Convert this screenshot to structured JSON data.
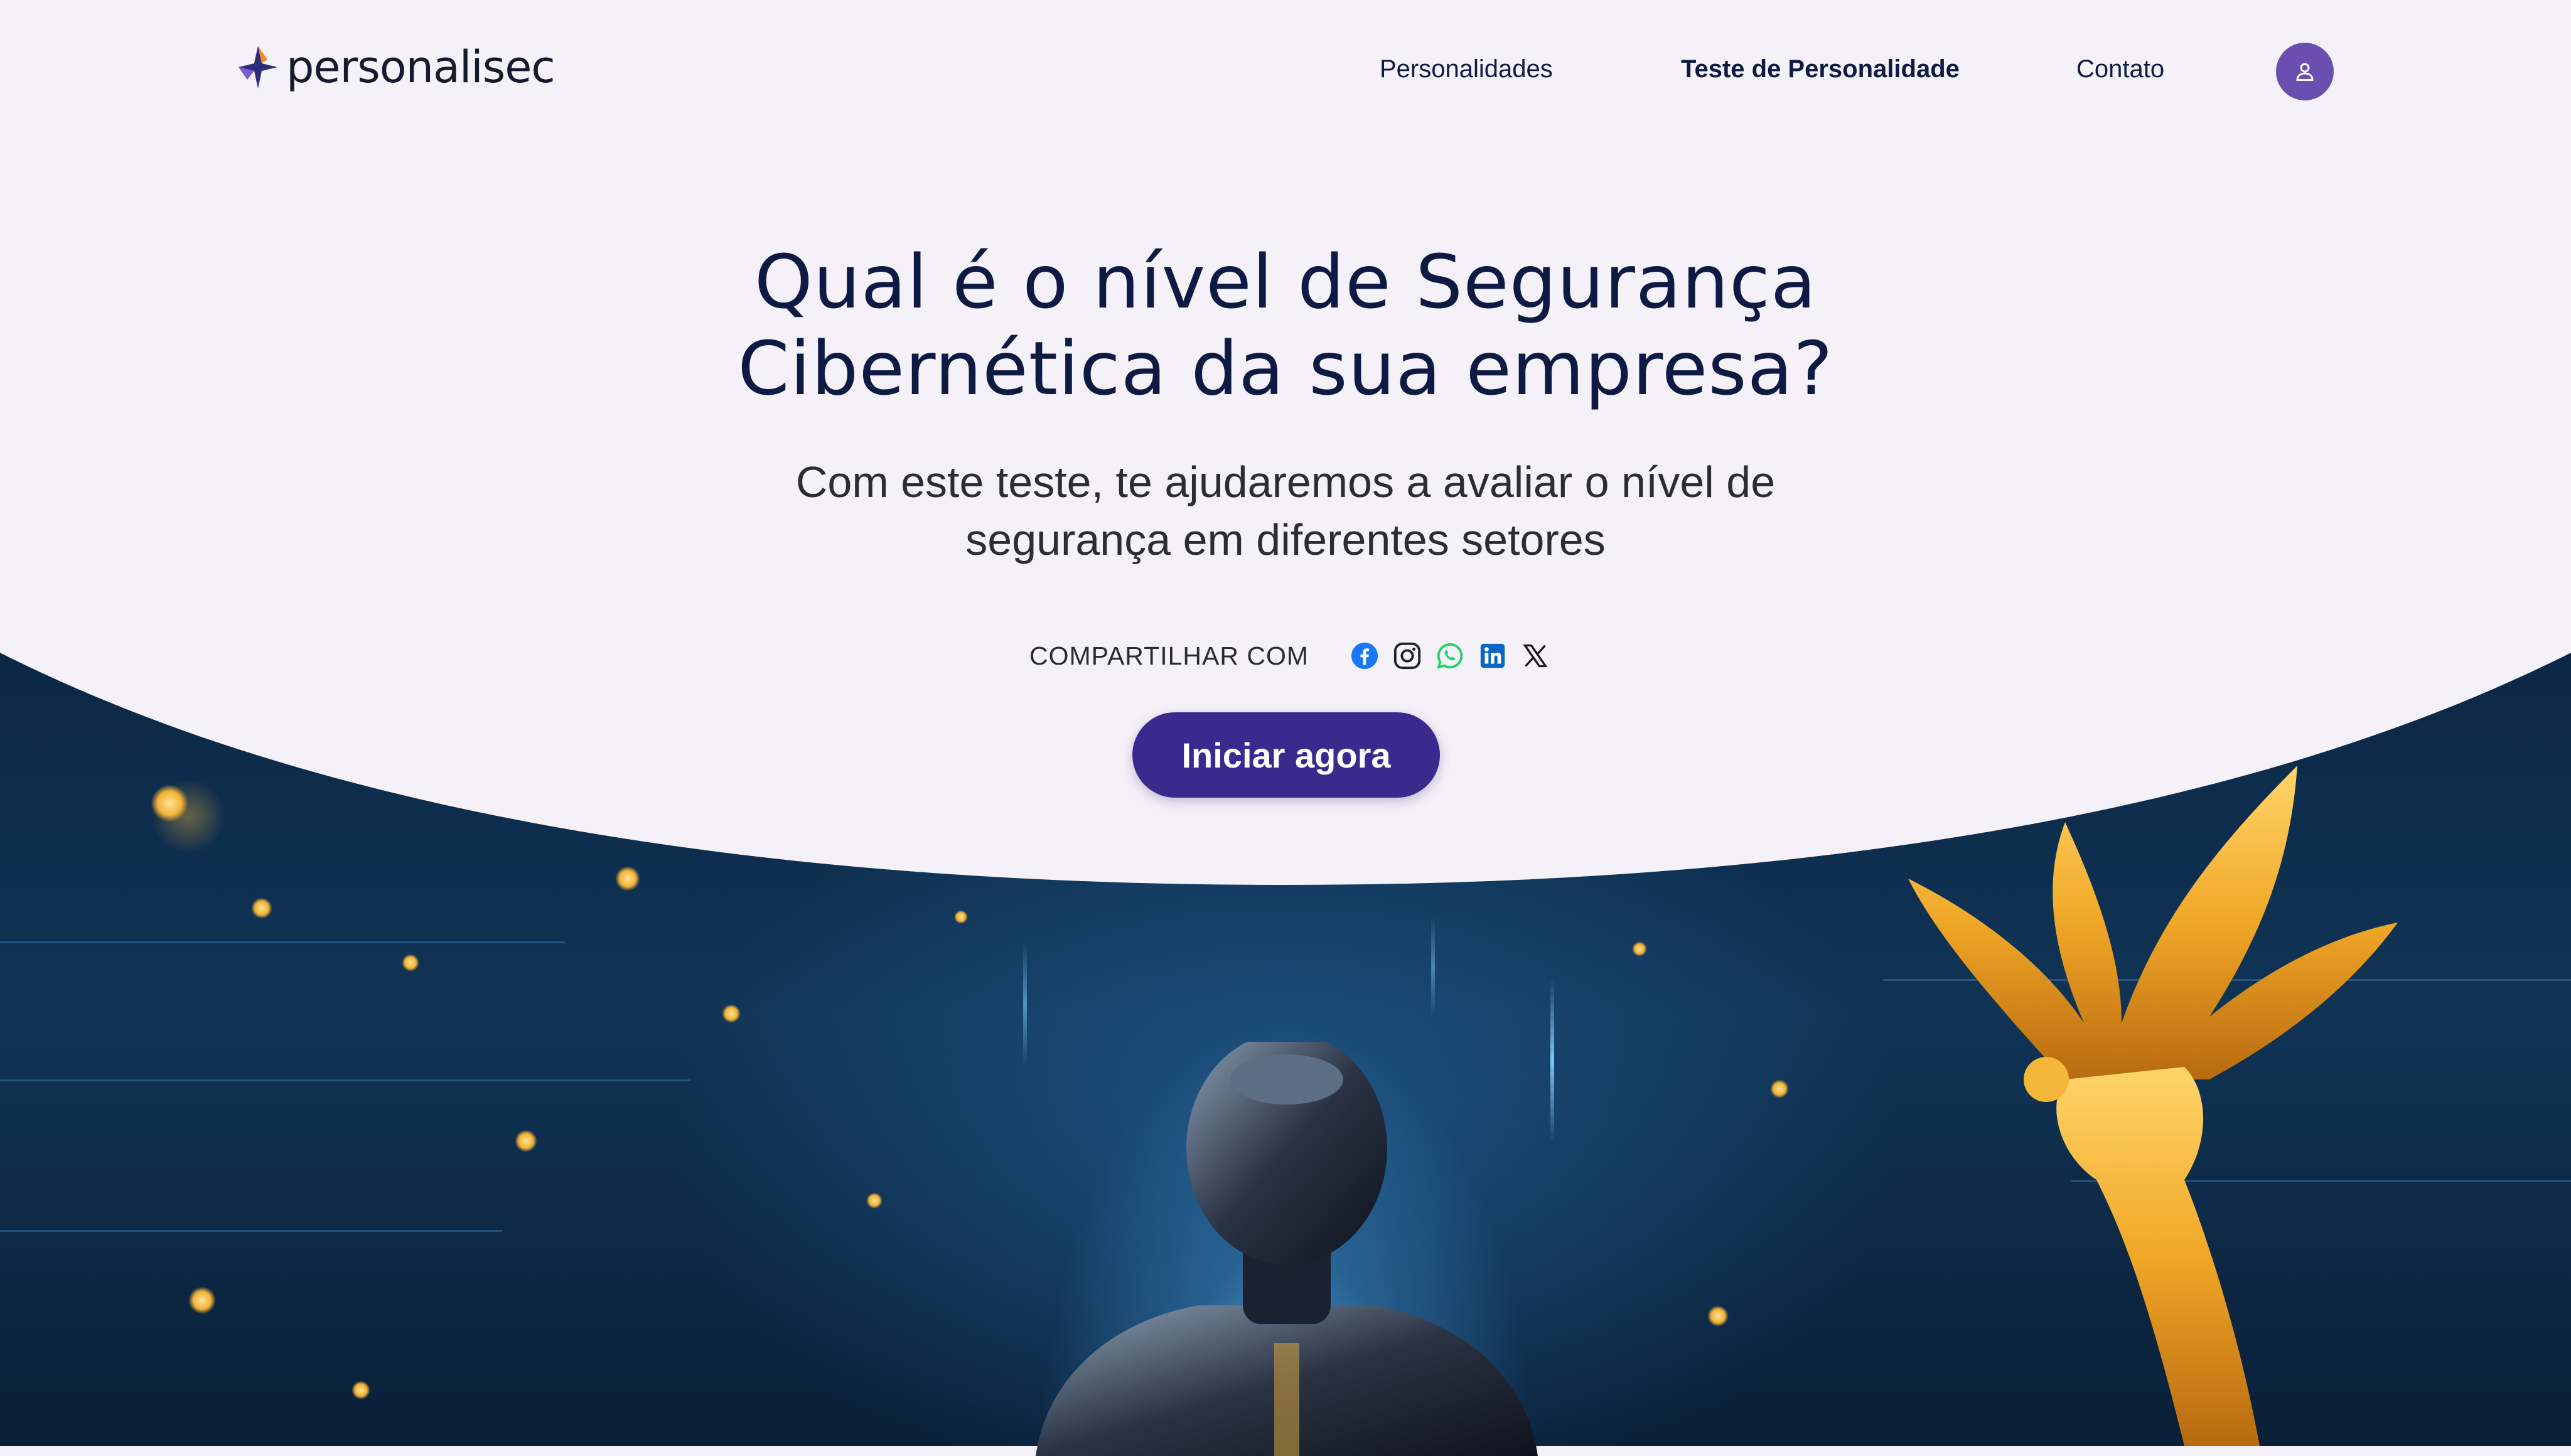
{
  "header": {
    "logo_text": "personalisec",
    "nav": {
      "personalidades": "Personalidades",
      "teste": "Teste de Personalidade",
      "contato": "Contato"
    },
    "avatar_icon": "user-icon"
  },
  "hero": {
    "title_line1": "Qual é o nível de Segurança",
    "title_line2": "Cibernética da sua empresa?",
    "subtitle_line1": "Com este teste, te ajudaremos a avaliar o nível de",
    "subtitle_line2": "segurança em diferentes setores",
    "share_label": "COMPARTILHAR COM",
    "share_icons": [
      "facebook-icon",
      "instagram-icon",
      "whatsapp-icon",
      "linkedin-icon",
      "x-icon"
    ],
    "cta_label": "Iniciar agora"
  },
  "colors": {
    "background": "#f5f1f8",
    "title": "#0f1a44",
    "cta": "#3b2a8e",
    "avatar": "#6a4fb0",
    "facebook": "#1877f2",
    "whatsapp": "#25d366",
    "linkedin": "#0a66c2"
  }
}
